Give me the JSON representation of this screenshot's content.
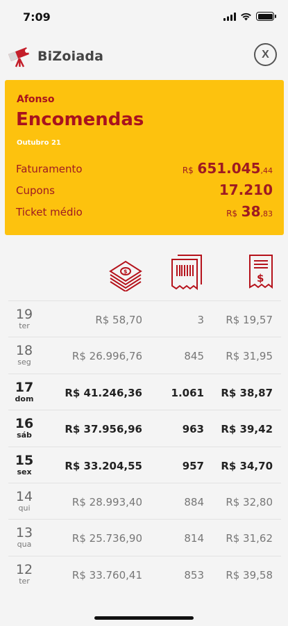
{
  "status": {
    "time": "7:09"
  },
  "app": {
    "logo_text": "BiZoiada",
    "close_label": "X"
  },
  "summary": {
    "name": "Afonso",
    "title": "Encomendas",
    "period": "Outubro 21",
    "metrics": [
      {
        "label": "Faturamento",
        "currency": "R$",
        "value": "651.045",
        "cents": ",44"
      },
      {
        "label": "Cupons",
        "currency": "",
        "value": "17.210",
        "cents": ""
      },
      {
        "label": "Ticket médio",
        "currency": "R$",
        "value": "38",
        "cents": ",83"
      }
    ]
  },
  "colors": {
    "accent_yellow": "#fdc20e",
    "accent_red": "#a8121e"
  },
  "columns": {
    "icons": [
      "money-stack-icon",
      "receipts-icon",
      "receipt-dollar-icon"
    ]
  },
  "rows": [
    {
      "day": "19",
      "weekday": "ter",
      "revenue": "R$ 58,70",
      "coupons": "3",
      "ticket": "R$ 19,57",
      "bold": false
    },
    {
      "day": "18",
      "weekday": "seg",
      "revenue": "R$ 26.996,76",
      "coupons": "845",
      "ticket": "R$ 31,95",
      "bold": false
    },
    {
      "day": "17",
      "weekday": "dom",
      "revenue": "R$ 41.246,36",
      "coupons": "1.061",
      "ticket": "R$ 38,87",
      "bold": true
    },
    {
      "day": "16",
      "weekday": "sáb",
      "revenue": "R$ 37.956,96",
      "coupons": "963",
      "ticket": "R$ 39,42",
      "bold": true
    },
    {
      "day": "15",
      "weekday": "sex",
      "revenue": "R$ 33.204,55",
      "coupons": "957",
      "ticket": "R$ 34,70",
      "bold": true
    },
    {
      "day": "14",
      "weekday": "qui",
      "revenue": "R$ 28.993,40",
      "coupons": "884",
      "ticket": "R$ 32,80",
      "bold": false
    },
    {
      "day": "13",
      "weekday": "qua",
      "revenue": "R$ 25.736,90",
      "coupons": "814",
      "ticket": "R$ 31,62",
      "bold": false
    },
    {
      "day": "12",
      "weekday": "ter",
      "revenue": "R$ 33.760,41",
      "coupons": "853",
      "ticket": "R$ 39,58",
      "bold": false
    }
  ]
}
